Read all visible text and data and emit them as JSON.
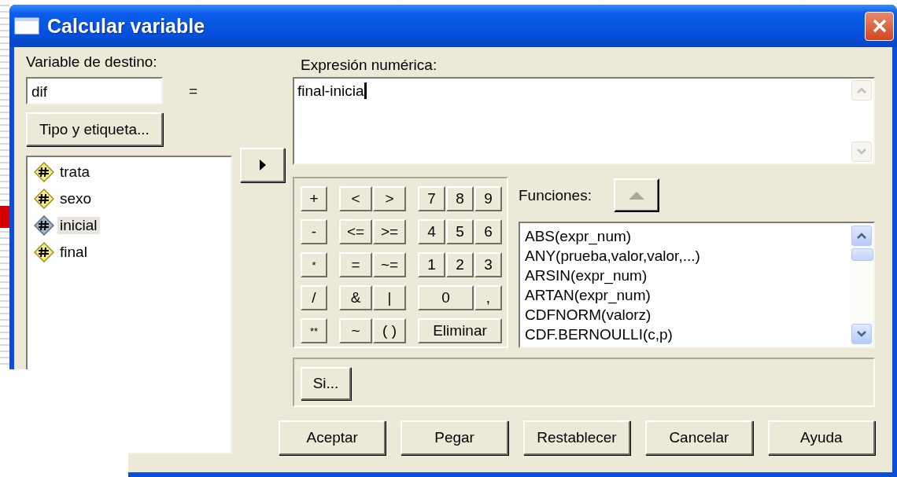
{
  "window": {
    "title": "Calcular variable"
  },
  "target": {
    "label": "Variable de destino:",
    "value": "dif",
    "equals": "=",
    "type_button": "Tipo y etiqueta..."
  },
  "variables": [
    {
      "name": "trata",
      "selected": false
    },
    {
      "name": "sexo",
      "selected": false
    },
    {
      "name": "inicial",
      "selected": true
    },
    {
      "name": "final",
      "selected": false
    }
  ],
  "expression": {
    "label": "Expresión numérica:",
    "value": "final-inicia"
  },
  "keypad": {
    "rows": [
      [
        {
          "label": "+",
          "kind": "key"
        },
        {
          "label": "<",
          "kind": "key"
        },
        {
          "label": ">",
          "kind": "key"
        },
        {
          "label": "7",
          "kind": "key"
        },
        {
          "label": "8",
          "kind": "key"
        },
        {
          "label": "9",
          "kind": "key"
        }
      ],
      [
        {
          "label": "-",
          "kind": "key"
        },
        {
          "label": "<=",
          "kind": "key"
        },
        {
          "label": ">=",
          "kind": "key"
        },
        {
          "label": "4",
          "kind": "key"
        },
        {
          "label": "5",
          "kind": "key"
        },
        {
          "label": "6",
          "kind": "key"
        }
      ],
      [
        {
          "label": "*",
          "kind": "key"
        },
        {
          "label": "=",
          "kind": "key"
        },
        {
          "label": "~=",
          "kind": "key"
        },
        {
          "label": "1",
          "kind": "key"
        },
        {
          "label": "2",
          "kind": "key"
        },
        {
          "label": "3",
          "kind": "key"
        }
      ],
      [
        {
          "label": "/",
          "kind": "key"
        },
        {
          "label": "&",
          "kind": "key"
        },
        {
          "label": "|",
          "kind": "key"
        },
        {
          "label": "0",
          "kind": "key"
        },
        {
          "kind": "span"
        },
        {
          "label": ",",
          "kind": "key"
        }
      ],
      [
        {
          "label": "**",
          "kind": "key"
        },
        {
          "label": "~",
          "kind": "key"
        },
        {
          "label": "( )",
          "kind": "key"
        },
        {
          "label": "Eliminar",
          "kind": "key"
        },
        {
          "kind": "span"
        },
        {
          "kind": "span"
        }
      ]
    ]
  },
  "functions": {
    "label": "Funciones:",
    "items": [
      "ABS(expr_num)",
      "ANY(prueba,valor,valor,...)",
      "ARSIN(expr_num)",
      "ARTAN(expr_num)",
      "CDFNORM(valorz)",
      "CDF.BERNOULLI(c,p)"
    ]
  },
  "if_button": "Si...",
  "buttons": [
    "Aceptar",
    "Pegar",
    "Restablecer",
    "Cancelar",
    "Ayuda"
  ]
}
